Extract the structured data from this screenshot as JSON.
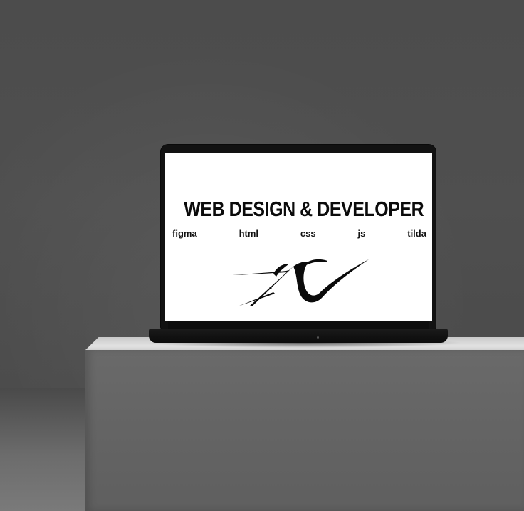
{
  "screen": {
    "title": "WEB DESIGN & DEVELOPER",
    "tags": [
      "figma",
      "html",
      "css",
      "js",
      "tilda"
    ],
    "logo_icon": "signature-logo-icon"
  },
  "colors": {
    "background": "#4c4c4c",
    "screen": "#ffffff",
    "text": "#0b0b0b",
    "laptop": "#121212",
    "pedestal_top": "#e2e2e2",
    "pedestal_front": "#656565"
  }
}
